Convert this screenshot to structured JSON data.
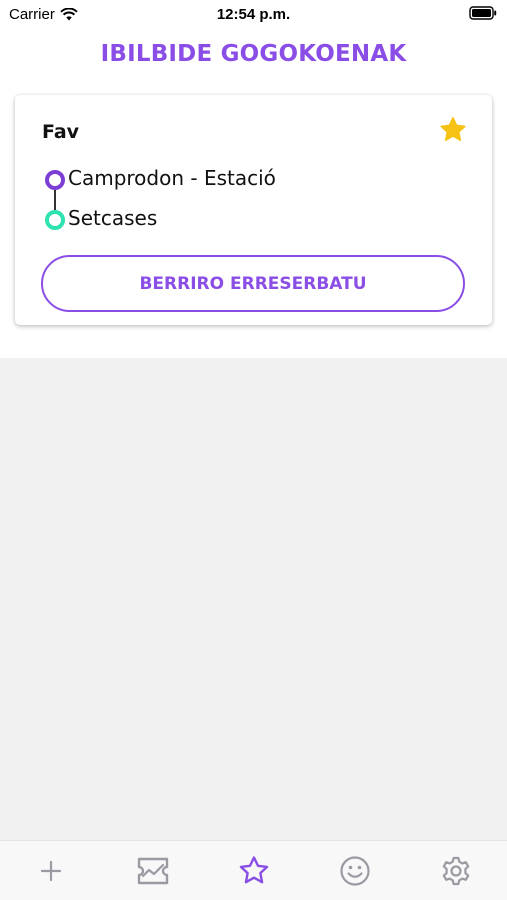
{
  "status_bar": {
    "carrier": "Carrier",
    "time": "12:54 p.m.",
    "icons": [
      "wifi-icon",
      "battery-icon"
    ]
  },
  "header": {
    "title": "IBILBIDE GOGOKOENAK"
  },
  "favorite_card": {
    "title": "Fav",
    "star_icon": "star-icon",
    "origin": "Camprodon - Estació",
    "destination": "Setcases",
    "rebook_label": "BERRIRO ERRESERBATU"
  },
  "tab_bar": {
    "tabs": [
      {
        "icon": "plus-icon",
        "active": false
      },
      {
        "icon": "ticket-icon",
        "active": false
      },
      {
        "icon": "star-outline-icon",
        "active": true
      },
      {
        "icon": "smiley-icon",
        "active": false
      },
      {
        "icon": "gear-icon",
        "active": false
      }
    ]
  },
  "colors": {
    "accent": "#8a4ee6",
    "star": "#f6c315",
    "origin_stop": "#7b3fd4",
    "destination_stop": "#2ee3b0",
    "tab_inactive": "#9a9aa3",
    "background": "#f1f1f2"
  }
}
